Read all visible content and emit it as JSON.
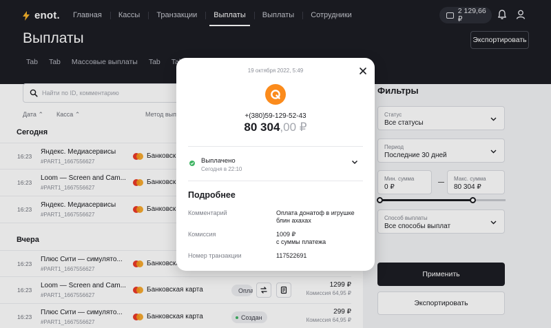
{
  "header": {
    "logo_text": "enot.",
    "nav": [
      "Главная",
      "Кассы",
      "Транзакции",
      "Выплаты",
      "Выплаты",
      "Сотрудники"
    ],
    "active_nav": 3,
    "balance": "2 129,66 ₽",
    "page_title": "Выплаты",
    "export_label": "Экспортировать",
    "tabs": [
      "Tab",
      "Tab",
      "Массовые выплаты",
      "Tab",
      "Tab"
    ]
  },
  "list": {
    "search_placeholder": "Найти по ID, комментарию",
    "columns": {
      "date": "Дата",
      "kassa": "Касса",
      "method": "Метод выпл"
    },
    "sections": {
      "today": "Сегодня",
      "yesterday": "Вчера"
    },
    "rows": [
      {
        "time": "16:23",
        "name": "Яндекс. Медиасервисы",
        "id": "#PART1_1667556627",
        "method": "Банковская карта"
      },
      {
        "time": "16:23",
        "name": "Loom — Screen and Cam...",
        "id": "#PART1_1667556627",
        "method": "Банковская карта"
      },
      {
        "time": "16:23",
        "name": "Яндекс. Медиасервисы",
        "id": "#PART1_1667556627",
        "method": "Банковская карта"
      },
      {
        "time": "16:23",
        "name": "Плюс Сити — симулято...",
        "id": "#PART1_1667556627",
        "method": "Банковская карта"
      },
      {
        "time": "16:23",
        "name": "Loom — Screen and Cam...",
        "id": "#PART1_1667556627",
        "method": "Банковская карта",
        "status": "Оплачено",
        "amount": "1299 ₽",
        "fee": "Комиссия 64,95 ₽"
      },
      {
        "time": "16:23",
        "name": "Плюс Сити — симулято...",
        "id": "#PART1_1667556627",
        "method": "Банковская карта",
        "status": "Создан",
        "amount": "299 ₽",
        "fee": "Комиссия 64,95 ₽"
      }
    ]
  },
  "filters": {
    "title": "Фильтры",
    "status": {
      "label": "Статус",
      "value": "Все статусы"
    },
    "period": {
      "label": "Период",
      "value": "Последние 30 дней"
    },
    "min": {
      "label": "Мин. сумма",
      "value": "0 ₽"
    },
    "max": {
      "label": "Макс. сумма",
      "value": "80 304 ₽"
    },
    "slider_fraction": 0.74,
    "method": {
      "label": "Способ выплаты",
      "value": "Все способы выплат"
    },
    "apply_label": "Применить",
    "export_label": "Экспортировать"
  },
  "modal": {
    "date": "19 октября 2022, 5:49",
    "phone": "+(380)59-129-52-43",
    "amount_int": "80 304",
    "amount_dec": ",00 ₽",
    "status": "Выплачено",
    "status_time": "Сегодня в 22:10",
    "section_title": "Подробнее",
    "details": {
      "comment_label": "Комментарий",
      "comment_value": "Оплата донатоф в игрушке блин ахахах",
      "fee_label": "Комиссия",
      "fee_value": "1009 ₽",
      "fee_note": "с суммы платежа",
      "txn_label": "Номер транзакции",
      "txn_value": "117522691"
    }
  },
  "colors": {
    "header_bg": "#1c1d24",
    "brand_orange": "#fb8b1c",
    "success_green": "#3fb463",
    "primary_button": "#1c1d24"
  }
}
